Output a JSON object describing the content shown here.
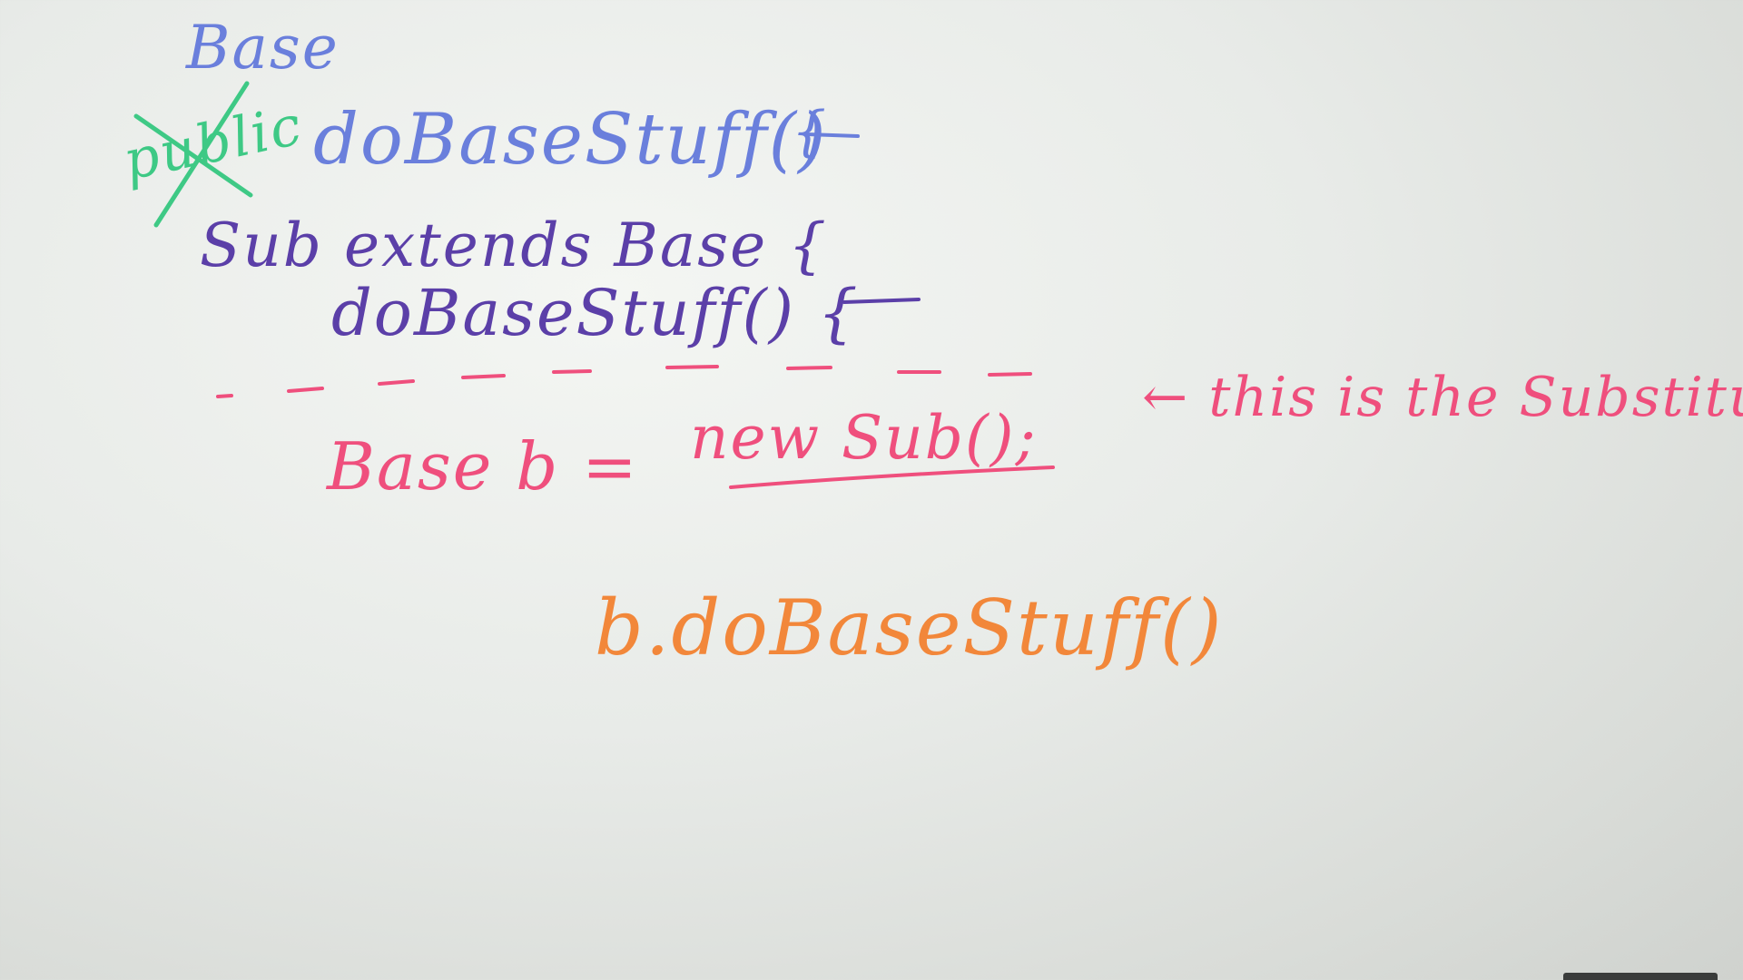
{
  "colors": {
    "blue": "#6a7fdc",
    "purple": "#5b3fa8",
    "pink": "#ef4f7d",
    "orange": "#f2873a",
    "green": "#3ec985",
    "board": "#e6e9e5"
  },
  "base_block": {
    "heading": "Base",
    "struck_modifier": "public",
    "method_signature": "doBaseStuff()",
    "open_brace": "{"
  },
  "sub_block": {
    "declaration": "Sub extends Base {",
    "method_signature": "doBaseStuff() {"
  },
  "assignment": {
    "left_side": "Base b =",
    "right_side": "new Sub();",
    "annotation": "← this is the Substitute"
  },
  "invocation": {
    "call": "b.doBaseStuff()"
  }
}
